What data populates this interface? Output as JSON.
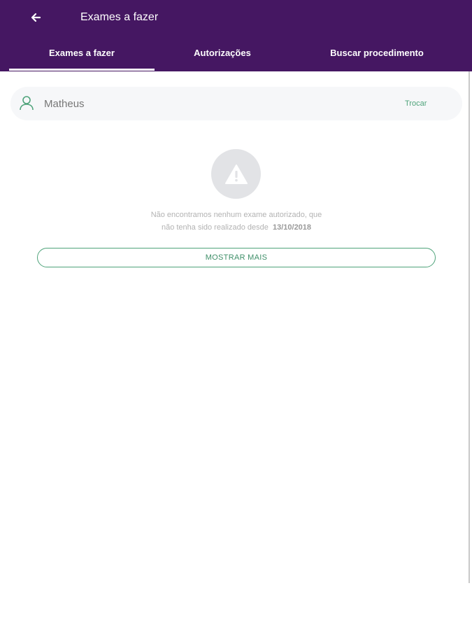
{
  "header": {
    "title": "Exames a fazer",
    "background_color": "#451762",
    "back_icon": "arrow-left-icon"
  },
  "tabs": [
    {
      "label": "Exames a fazer",
      "active": true
    },
    {
      "label": "Autorizações",
      "active": false
    },
    {
      "label": "Buscar procedimento",
      "active": false
    }
  ],
  "member": {
    "icon": "person-icon",
    "name": "Matheus",
    "action_label": "Trocar",
    "accent_color": "#4ea37a"
  },
  "empty_state": {
    "icon": "warning-triangle-icon",
    "message_line1": "Não encontramos nenhum exame autorizado, que",
    "message_line2": "não tenha sido realizado desde",
    "date": "13/10/2018"
  },
  "show_more": {
    "label": "MOSTRAR MAIS"
  }
}
